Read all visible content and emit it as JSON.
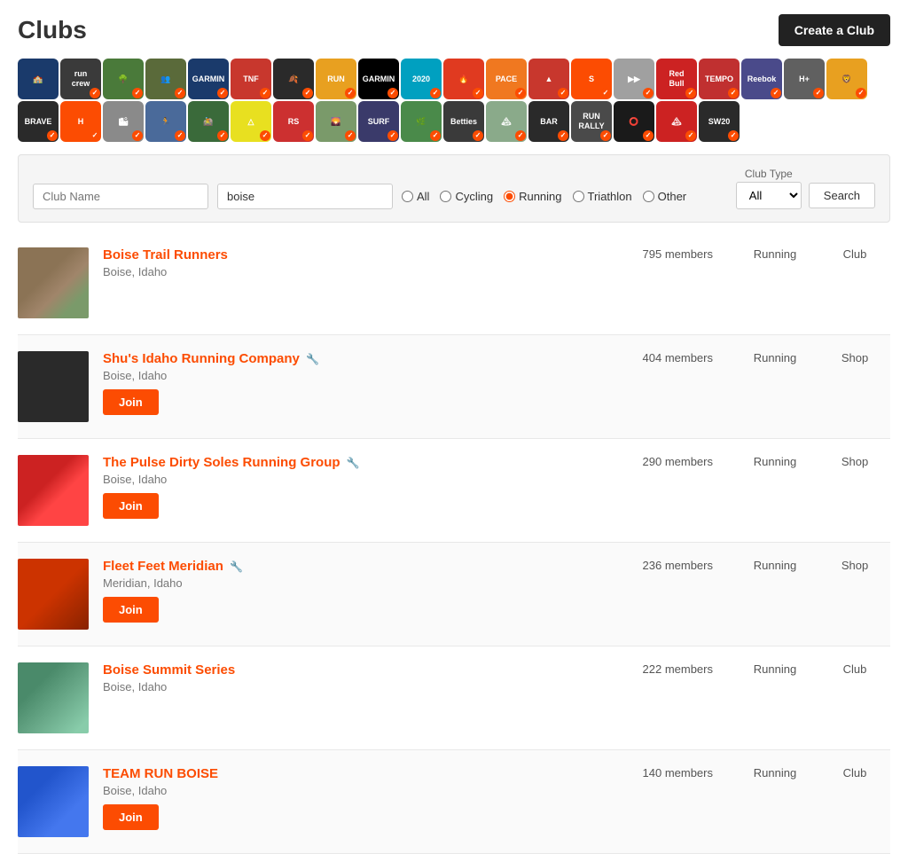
{
  "page": {
    "title": "Clubs",
    "create_button": "Create a Club"
  },
  "search": {
    "club_name_placeholder": "Club Name",
    "location_value": "boise",
    "club_type_label": "Club Type",
    "radio_options": [
      {
        "label": "All",
        "value": "all",
        "checked": false
      },
      {
        "label": "Cycling",
        "value": "cycling",
        "checked": false
      },
      {
        "label": "Running",
        "value": "running",
        "checked": true
      },
      {
        "label": "Triathlon",
        "value": "triathlon",
        "checked": false
      },
      {
        "label": "Other",
        "value": "other",
        "checked": false
      }
    ],
    "select_label": "All",
    "search_button": "Search"
  },
  "clubs": [
    {
      "name": "Boise Trail Runners",
      "location": "Boise, Idaho",
      "members": "795 members",
      "type": "Running",
      "category": "Club",
      "has_join": false,
      "has_wrench": false,
      "img_class": "img-trail"
    },
    {
      "name": "Shu's Idaho Running Company",
      "location": "Boise, Idaho",
      "members": "404 members",
      "type": "Running",
      "category": "Shop",
      "has_join": true,
      "has_wrench": true,
      "img_class": "img-run"
    },
    {
      "name": "The Pulse Dirty Soles Running Group",
      "location": "Boise, Idaho",
      "members": "290 members",
      "type": "Running",
      "category": "Shop",
      "has_join": true,
      "has_wrench": true,
      "img_class": "img-pulse"
    },
    {
      "name": "Fleet Feet Meridian",
      "location": "Meridian, Idaho",
      "members": "236 members",
      "type": "Running",
      "category": "Shop",
      "has_join": true,
      "has_wrench": true,
      "img_class": "img-fleet"
    },
    {
      "name": "Boise Summit Series",
      "location": "Boise, Idaho",
      "members": "222 members",
      "type": "Running",
      "category": "Club",
      "has_join": false,
      "has_wrench": false,
      "img_class": "img-summit"
    },
    {
      "name": "TEAM RUN BOISE",
      "location": "Boise, Idaho",
      "members": "140 members",
      "type": "Running",
      "category": "Club",
      "has_join": true,
      "has_wrench": false,
      "img_class": "img-teamrun"
    }
  ],
  "join_label": "Join",
  "logos": [
    {
      "text": "🏫",
      "color": "#1a3a6b"
    },
    {
      "text": "run\ncrew",
      "color": "#3a3a3a"
    },
    {
      "text": "🌳",
      "color": "#4a7a3a"
    },
    {
      "text": "👥",
      "color": "#5a6a3a"
    },
    {
      "text": "GARMIN",
      "color": "#1a3a6b"
    },
    {
      "text": "TNF",
      "color": "#c8372d"
    },
    {
      "text": "🍂",
      "color": "#2a2a2a"
    },
    {
      "text": "RUN",
      "color": "#e8a020"
    },
    {
      "text": "GARMIN",
      "color": "#000"
    },
    {
      "text": "20/20",
      "color": "#00a0c0"
    },
    {
      "text": "🔥",
      "color": "#e03a20"
    },
    {
      "text": "PACE",
      "color": "#f07820"
    },
    {
      "text": "▲",
      "color": "#c8372d"
    },
    {
      "text": "STRAVA",
      "color": "#fc4c02"
    },
    {
      "text": "▶▶",
      "color": "#86bf31"
    },
    {
      "text": "RedBull",
      "color": "#cc2222"
    },
    {
      "text": "TEMPO",
      "color": "#c03030"
    },
    {
      "text": "Reebok",
      "color": "#4a4a8a"
    },
    {
      "text": "#",
      "color": "#606060"
    },
    {
      "text": "🦁",
      "color": "#e8a020"
    },
    {
      "text": "BRAVE",
      "color": "#2a2a2a"
    },
    {
      "text": "H+",
      "color": "#fc4c02"
    },
    {
      "text": "🏙",
      "color": "#8a8a8a"
    },
    {
      "text": "🏃",
      "color": "#4a6a9a"
    },
    {
      "text": "🚵",
      "color": "#3a6a3a"
    },
    {
      "text": "△",
      "color": "#e8e020"
    },
    {
      "text": "RS",
      "color": "#cc3030"
    },
    {
      "text": "🌄",
      "color": "#7a9a6a"
    },
    {
      "text": "SURF",
      "color": "#3a3a6a"
    },
    {
      "text": "🌿",
      "color": "#4a8a4a"
    },
    {
      "text": "BOISE\nBetties",
      "color": "#3a3a3a"
    },
    {
      "text": "🏔",
      "color": "#8aaa8a"
    },
    {
      "text": "BAR",
      "color": "#2a2a2a"
    },
    {
      "text": "RUN\nRALLY",
      "color": "#4a4a4a"
    },
    {
      "text": "⭕",
      "color": "#1a1a1a"
    },
    {
      "text": "🏔",
      "color": "#cc2222"
    },
    {
      "text": "SW20",
      "color": "#2a2a2a"
    }
  ]
}
